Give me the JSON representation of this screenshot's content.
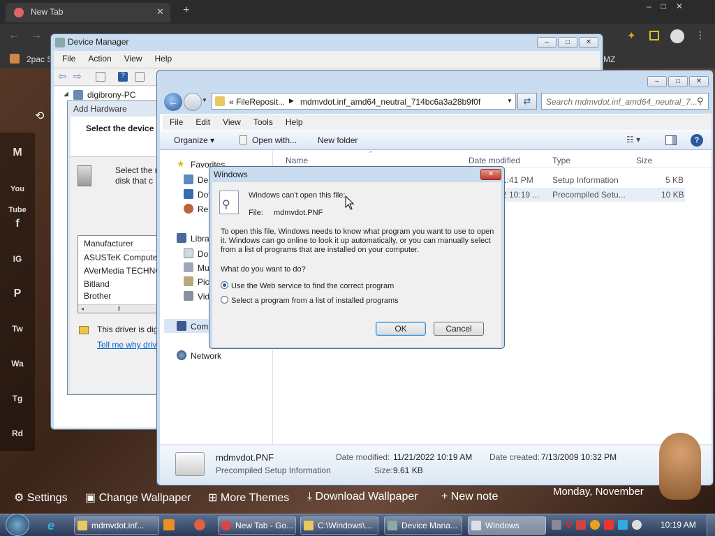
{
  "browser": {
    "tab_title": "New Tab",
    "bookmark": "2pac S",
    "right_partial": "MZ"
  },
  "device_manager": {
    "title": "Device Manager",
    "menu": [
      "File",
      "Action",
      "View",
      "Help"
    ],
    "tree_root": "digibrony-PC",
    "add_hardware": {
      "title": "Add Hardware",
      "heading": "Select the device",
      "desc_line1": "Select the m",
      "desc_line2": "disk that c",
      "manufacturer_header": "Manufacturer",
      "manufacturers": [
        "ASUSTeK Computer",
        "AVerMedia TECHNO",
        "Bitland",
        "Brother"
      ],
      "driver_note": "This driver is dig",
      "driver_link": "Tell me why driv"
    }
  },
  "explorer": {
    "address_parts": [
      "« FileReposit...",
      "mdmvdot.inf_amd64_neutral_714bc6a3a28b9f0f"
    ],
    "search_placeholder": "Search mdmvdot.inf_amd64_neutral_7...",
    "menu": [
      "File",
      "Edit",
      "View",
      "Tools",
      "Help"
    ],
    "toolbar": {
      "organize": "Organize",
      "open_with": "Open with...",
      "new_folder": "New folder"
    },
    "columns": {
      "name": "Name",
      "date": "Date modified",
      "type": "Type",
      "size": "Size"
    },
    "files": [
      {
        "date": "1:41 PM",
        "type": "Setup Information",
        "size": "5 KB"
      },
      {
        "date": "2 10:19 ...",
        "type": "Precompiled Setu...",
        "size": "10 KB"
      }
    ],
    "nav": {
      "favorites": "Favorites",
      "fav_items": [
        "Des",
        "Dov",
        "Rec"
      ],
      "libraries": "Libra",
      "lib_items": [
        "Doc",
        "Mu",
        "Pic",
        "Vid"
      ],
      "computer": "Com",
      "network": "Network"
    },
    "details": {
      "filename": "mdmvdot.PNF",
      "filetype": "Precompiled Setup Information",
      "modified_label": "Date modified:",
      "modified_value": "11/21/2022 10:19 AM",
      "created_label": "Date created:",
      "created_value": "7/13/2009 10:32 PM",
      "size_label": "Size:",
      "size_value": "9.61 KB"
    }
  },
  "dialog": {
    "title": "Windows",
    "heading": "Windows can't open this file:",
    "file_label": "File:",
    "file_value": "mdmvdot.PNF",
    "body": "To open this file, Windows needs to know what program you want to use to open it. Windows can go online to look it up automatically, or you can manually select from a list of programs that are installed on your computer.",
    "question": "What do you want to do?",
    "option1": "Use the Web service to find the correct program",
    "option2": "Select a program from a list of installed programs",
    "ok": "OK",
    "cancel": "Cancel"
  },
  "side_icons": [
    "M",
    "You Tube",
    "f",
    "IG",
    "P",
    "Tw",
    "Wa",
    "Tg",
    "Rd"
  ],
  "desktop_bar": {
    "settings": "Settings",
    "change_wallpaper": "Change Wallpaper",
    "more_themes": "More Themes",
    "download_wallpaper": "Download Wallpaper",
    "new_note": "+ New note",
    "date": "Monday, November"
  },
  "taskbar": {
    "buttons": [
      "mdmvdot.inf...",
      "New Tab - Go...",
      "C:\\Windows\\...",
      "Device Mana...",
      "Windows"
    ],
    "clock": "10:19 AM"
  },
  "colors": {
    "accent": "#2a5aa0",
    "selection": "#cde8ff"
  }
}
